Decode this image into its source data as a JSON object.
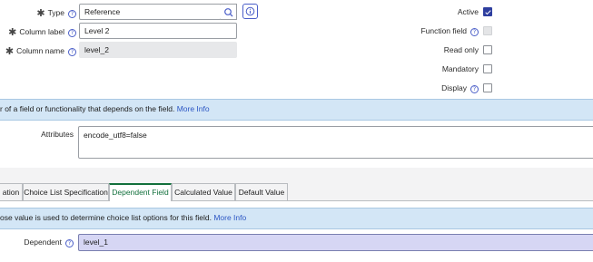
{
  "form": {
    "type": {
      "label": "Type",
      "value": "Reference"
    },
    "column_label": {
      "label": "Column label",
      "value": "Level 2"
    },
    "column_name": {
      "label": "Column name",
      "value": "level_2"
    },
    "active": {
      "label": "Active",
      "checked": true
    },
    "function_field": {
      "label": "Function field",
      "checked": false
    },
    "read_only": {
      "label": "Read only",
      "checked": false
    },
    "mandatory": {
      "label": "Mandatory",
      "checked": false
    },
    "display": {
      "label": "Display",
      "checked": false
    },
    "attributes": {
      "label": "Attributes",
      "value": "encode_utf8=false"
    },
    "dependent": {
      "label": "Dependent",
      "value": "level_1"
    }
  },
  "banner1": {
    "text": "r of a field or functionality that depends on the field.",
    "link": "More Info"
  },
  "banner2": {
    "text": "ose value is used to determine choice list options for this field.",
    "link": "More Info"
  },
  "tabs": [
    {
      "label": "ation",
      "active": false
    },
    {
      "label": "Choice List Specification",
      "active": false
    },
    {
      "label": "Dependent Field",
      "active": true
    },
    {
      "label": "Calculated Value",
      "active": false
    },
    {
      "label": "Default Value",
      "active": false
    }
  ],
  "icons": {
    "required": "asterisk-icon",
    "help": "question-circle-icon",
    "search": "search-icon",
    "info": "info-icon"
  },
  "colors": {
    "accent": "#2e3e9f",
    "active_tab": "#12703c",
    "banner": "#d3e6f6",
    "link": "#2d57c4",
    "dependent_bg": "#d6d6f4"
  }
}
